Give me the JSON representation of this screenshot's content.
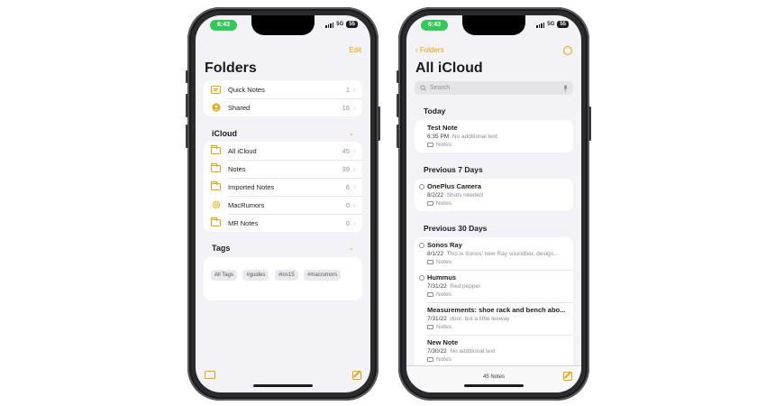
{
  "status_bar": {
    "time": "6:43",
    "network": "5G",
    "battery": "55"
  },
  "folders_screen": {
    "edit_label": "Edit",
    "title": "Folders",
    "top_items": [
      {
        "label": "Quick Notes",
        "count": "1",
        "icon": "quick-notes-icon"
      },
      {
        "label": "Shared",
        "count": "16",
        "icon": "shared-icon"
      }
    ],
    "icloud_header": "iCloud",
    "icloud_items": [
      {
        "label": "All iCloud",
        "count": "45",
        "icon": "folder-icon"
      },
      {
        "label": "Notes",
        "count": "39",
        "icon": "folder-icon"
      },
      {
        "label": "Imported Notes",
        "count": "6",
        "icon": "folder-icon"
      },
      {
        "label": "MacRumors",
        "count": "0",
        "icon": "gear-icon"
      },
      {
        "label": "MR Notes",
        "count": "0",
        "icon": "folder-icon"
      }
    ],
    "tags_header": "Tags",
    "tags": [
      "All Tags",
      "#guides",
      "#ios15",
      "#macrumors"
    ]
  },
  "notes_screen": {
    "back_label": "Folders",
    "title": "All iCloud",
    "search_placeholder": "Search",
    "groups": [
      {
        "header": "Today",
        "notes": [
          {
            "title": "Test Note",
            "date": "6:35 PM",
            "preview": "No additional text",
            "folder": "Notes",
            "shared": false
          }
        ]
      },
      {
        "header": "Previous 7 Days",
        "notes": [
          {
            "title": "OnePlus Camera",
            "date": "8/2/22",
            "preview": "Shots needed",
            "folder": "Notes",
            "shared": true
          }
        ]
      },
      {
        "header": "Previous 30 Days",
        "notes": [
          {
            "title": "Sonos Ray",
            "date": "8/1/22",
            "preview": "This is Sonos' new Ray soundbar, design...",
            "folder": "Notes",
            "shared": true
          },
          {
            "title": "Hummus",
            "date": "7/31/22",
            "preview": "Red pepper",
            "folder": "Notes",
            "shared": true
          },
          {
            "title": "Measurements: shoe rack and bench abo...",
            "date": "7/31/22",
            "preview": "door, but a little leeway",
            "folder": "Notes",
            "shared": false
          },
          {
            "title": "New Note",
            "date": "7/30/22",
            "preview": "No additional text",
            "folder": "Notes",
            "shared": false
          }
        ]
      }
    ],
    "notes_count": "45 Notes"
  },
  "colors": {
    "accent": "#e5a50a",
    "background": "#f2f2f7",
    "status_green": "#34c759"
  }
}
